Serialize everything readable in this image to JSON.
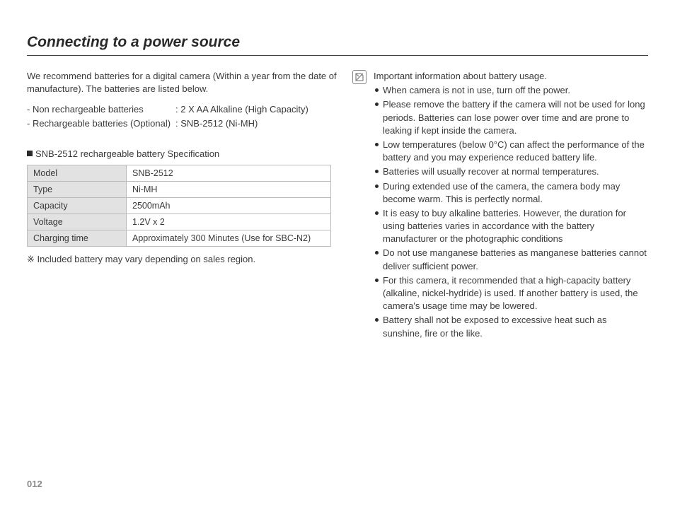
{
  "title": "Connecting to a power source",
  "intro": "We recommend batteries for a digital camera (Within a year from the date of manufacture). The batteries are listed below.",
  "battery_types": [
    {
      "label": "- Non rechargeable batteries",
      "value": ": 2 X AA Alkaline (High Capacity)"
    },
    {
      "label": "- Rechargeable batteries (Optional)",
      "value": ": SNB-2512 (Ni-MH)"
    }
  ],
  "spec_heading": "SNB-2512 rechargeable battery Specification",
  "spec_table": [
    {
      "label": "Model",
      "value": "SNB-2512"
    },
    {
      "label": "Type",
      "value": "Ni-MH"
    },
    {
      "label": "Capacity",
      "value": "2500mAh"
    },
    {
      "label": "Voltage",
      "value": "1.2V x 2"
    },
    {
      "label": "Charging time",
      "value": "Approximately 300 Minutes (Use for SBC-N2)"
    }
  ],
  "footnote_symbol": "※",
  "footnote": "Included battery may vary depending on sales region.",
  "info_title": "Important information about battery usage.",
  "info_bullets": [
    "When camera is not in use, turn off the power.",
    "Please remove the battery if the camera will not be used for long periods. Batteries can lose power over time and are prone to leaking if kept inside the camera.",
    "Low temperatures (below 0°C) can affect the performance of the battery and you may experience reduced battery life.",
    "Batteries will usually recover at normal temperatures.",
    "During extended use of the camera, the camera body may become warm. This is perfectly normal.",
    "It is easy to buy alkaline batteries. However, the duration for using batteries varies in accordance with the battery manufacturer or the photographic conditions",
    "Do not use manganese batteries as manganese batteries cannot deliver sufficient power.",
    "For this camera, it recommended that a high-capacity battery (alkaline, nickel-hydride) is used. If another battery is used, the camera's usage time may be lowered.",
    "Battery shall not be exposed to excessive heat such as sunshine, fire or the like."
  ],
  "page_number": "012"
}
